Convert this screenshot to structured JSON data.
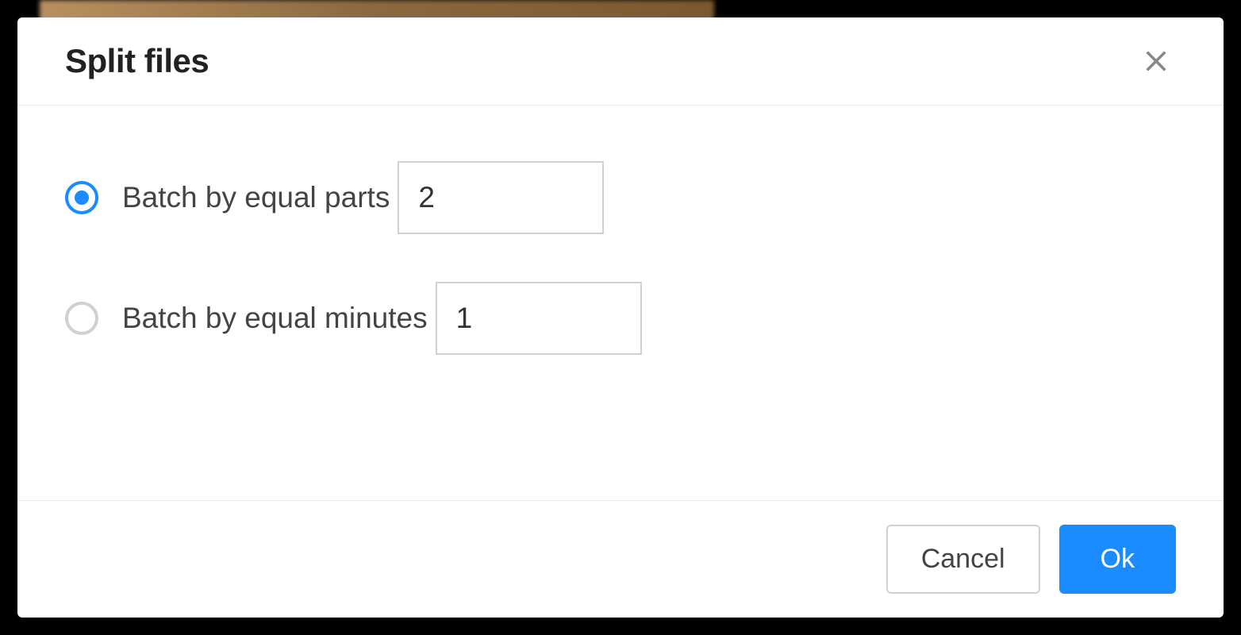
{
  "dialog": {
    "title": "Split files",
    "options": {
      "parts": {
        "label": "Batch by equal parts",
        "value": "2",
        "selected": true
      },
      "minutes": {
        "label": "Batch by equal minutes",
        "value": "1",
        "selected": false
      }
    },
    "footer": {
      "cancel_label": "Cancel",
      "ok_label": "Ok"
    }
  }
}
